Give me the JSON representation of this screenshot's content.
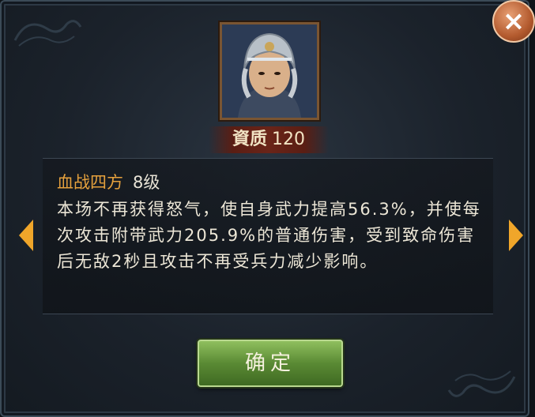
{
  "header": {
    "close_icon": "close-icon",
    "close_label": "×"
  },
  "hero": {
    "portrait_icon": "hero-portrait",
    "aptitude_label": "資质",
    "aptitude_value": "120"
  },
  "skill": {
    "name": "血战四方",
    "level": "8级",
    "description": "本场不再获得怒气，使自身武力提高56.3%，并使每次攻击附带武力205.9%的普通伤害，受到致命伤害后无敌2秒且攻击不再受兵力减少影响。"
  },
  "nav": {
    "prev_icon": "arrow-left-icon",
    "next_icon": "arrow-right-icon",
    "arrow_color": "#f0a62a"
  },
  "actions": {
    "confirm_label": "确定"
  },
  "colors": {
    "skill_name": "#e6a13d",
    "confirm_button": "#5a8a34",
    "close_button": "#b35a2e"
  }
}
